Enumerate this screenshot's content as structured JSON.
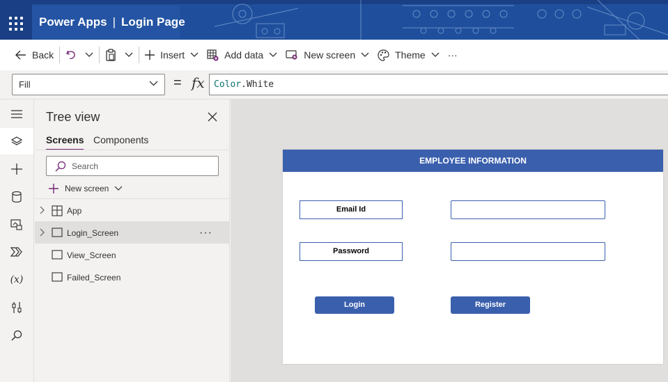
{
  "header": {
    "app_name": "Power Apps",
    "separator": "|",
    "doc_title": "Login Page",
    "colors": {
      "bar": "#1f4f9c",
      "text": "#ffffff"
    }
  },
  "commandbar": {
    "back_label": "Back",
    "insert_label": "Insert",
    "add_data_label": "Add data",
    "new_screen_label": "New screen",
    "theme_label": "Theme",
    "more_label": "···"
  },
  "formula_bar": {
    "property": "Fill",
    "equals": "=",
    "fx": "fx",
    "formula_object": "Color",
    "formula_dot": ".",
    "formula_member": "White"
  },
  "left_rail": {
    "items": [
      "menu-icon",
      "layers-icon",
      "plus-icon",
      "database-icon",
      "media-icon",
      "power-automate-icon",
      "variables-icon",
      "tools-icon",
      "search-icon"
    ],
    "variables_glyph": "(x)"
  },
  "tree_view": {
    "title": "Tree view",
    "tabs": [
      {
        "label": "Screens",
        "active": true
      },
      {
        "label": "Components",
        "active": false
      }
    ],
    "search_placeholder": "Search",
    "new_screen_label": "New screen",
    "items": [
      {
        "label": "App",
        "expandable": true,
        "selected": false,
        "icon": "app-icon"
      },
      {
        "label": "Login_Screen",
        "expandable": true,
        "selected": true,
        "icon": "screen-icon"
      },
      {
        "label": "View_Screen",
        "expandable": false,
        "selected": false,
        "icon": "screen-icon"
      },
      {
        "label": "Failed_Screen",
        "expandable": false,
        "selected": false,
        "icon": "screen-icon"
      }
    ],
    "more_label": "···"
  },
  "canvas": {
    "header_text": "EMPLOYEE INFORMATION",
    "email_label": "Email Id",
    "password_label": "Password",
    "email_value": "",
    "password_value": "",
    "login_button": "Login",
    "register_button": "Register",
    "colors": {
      "accent": "#3a5fad",
      "screen_bg": "#ffffff",
      "workspace_bg": "#e1dfdd"
    }
  }
}
